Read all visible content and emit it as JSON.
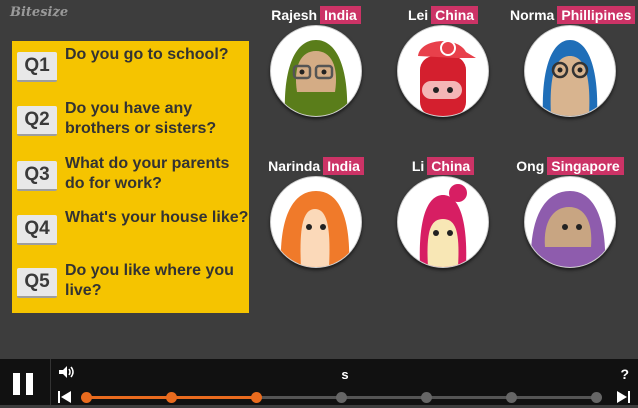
{
  "brand": {
    "logo": "Bitesize"
  },
  "questions": [
    {
      "tag": "Q1",
      "text": "Do you go to school?"
    },
    {
      "tag": "Q2",
      "text": "Do you have any brothers or sisters?"
    },
    {
      "tag": "Q3",
      "text": "What do your parents do for work?"
    },
    {
      "tag": "Q4",
      "text": "What's your house like?"
    },
    {
      "tag": "Q5",
      "text": "Do you like where you live?"
    }
  ],
  "people": [
    {
      "name": "Rajesh",
      "country": "India",
      "icon": "rajesh-avatar"
    },
    {
      "name": "Lei",
      "country": "China",
      "icon": "lei-avatar"
    },
    {
      "name": "Norma",
      "country": "Phillipines",
      "icon": "norma-avatar"
    },
    {
      "name": "Narinda",
      "country": "India",
      "icon": "narinda-avatar"
    },
    {
      "name": "Li",
      "country": "China",
      "icon": "li-avatar"
    },
    {
      "name": "Ong",
      "country": "Singapore",
      "icon": "ong-avatar"
    }
  ],
  "player": {
    "title": "s",
    "help": "?",
    "state": "playing",
    "current_step": 3,
    "total_steps": 7,
    "icons": [
      "pause-icon",
      "volume-icon",
      "previous-icon",
      "next-icon"
    ]
  },
  "colors": {
    "accent": "#e96b1e",
    "panel": "#f5c400",
    "country_badge": "#cc3366",
    "background": "#3d3d3d"
  }
}
